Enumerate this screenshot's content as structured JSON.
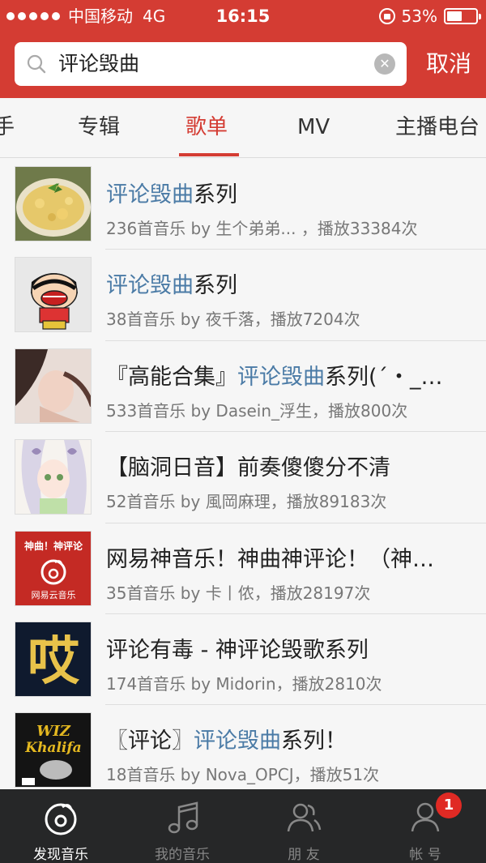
{
  "status_bar": {
    "carrier": "中国移动",
    "network": "4G",
    "time": "16:15",
    "battery": "53%",
    "battery_level": 0.53
  },
  "search": {
    "query": "评论毁曲",
    "cancel_label": "取消"
  },
  "tabs": [
    {
      "label": "手",
      "active": false
    },
    {
      "label": "专辑",
      "active": false
    },
    {
      "label": "歌单",
      "active": true
    },
    {
      "label": "MV",
      "active": false
    },
    {
      "label": "主播电台",
      "active": false
    }
  ],
  "playlists": [
    {
      "title_pre": "",
      "title_hl": "评论毁曲",
      "title_post": "系列",
      "meta": "236首音乐  by 生个弟弟... ，播放33384次"
    },
    {
      "title_pre": "",
      "title_hl": "评论毁曲",
      "title_post": "系列",
      "meta": "38首音乐  by 夜千落，播放7204次"
    },
    {
      "title_pre": "『高能合集』",
      "title_hl": "评论毁曲",
      "title_post": "系列(´・_…",
      "meta": "533首音乐  by Dasein_浮生，播放800次"
    },
    {
      "title_pre": "【脑洞日音】前奏傻傻分不清",
      "title_hl": "",
      "title_post": "",
      "meta": "52首音乐  by 風岡麻理，播放89183次"
    },
    {
      "title_pre": "网易神音乐！神曲神评论！（神…",
      "title_hl": "",
      "title_post": "",
      "meta": "35首音乐  by 卡丨侬，播放28197次"
    },
    {
      "title_pre": "评论有毒 - 神评论毁歌系列",
      "title_hl": "",
      "title_post": "",
      "meta": "174首音乐  by Midorin，播放2810次"
    },
    {
      "title_pre": "〖评论〗",
      "title_hl": "评论毁曲",
      "title_post": "系列！",
      "meta": "18首音乐  by Nova_OPCJ，播放51次"
    }
  ],
  "thumb_texts": {
    "netease_line1": "神曲！神评论",
    "netease_line2": "网易云音乐",
    "calligraphy": "哎",
    "wiz_line1": "WIZ",
    "wiz_line2": "Khalifa"
  },
  "tab_bar": [
    {
      "label": "发现音乐",
      "icon": "netease-music-icon",
      "active": true
    },
    {
      "label": "我的音乐",
      "icon": "music-note-icon",
      "active": false
    },
    {
      "label": "朋 友",
      "icon": "friends-icon",
      "active": false
    },
    {
      "label": "帐 号",
      "icon": "account-icon",
      "active": false,
      "badge": "1"
    }
  ],
  "colors": {
    "brand_red": "#d43c33",
    "highlight_blue": "#4b7ba6",
    "tabbar_bg": "#262728"
  }
}
